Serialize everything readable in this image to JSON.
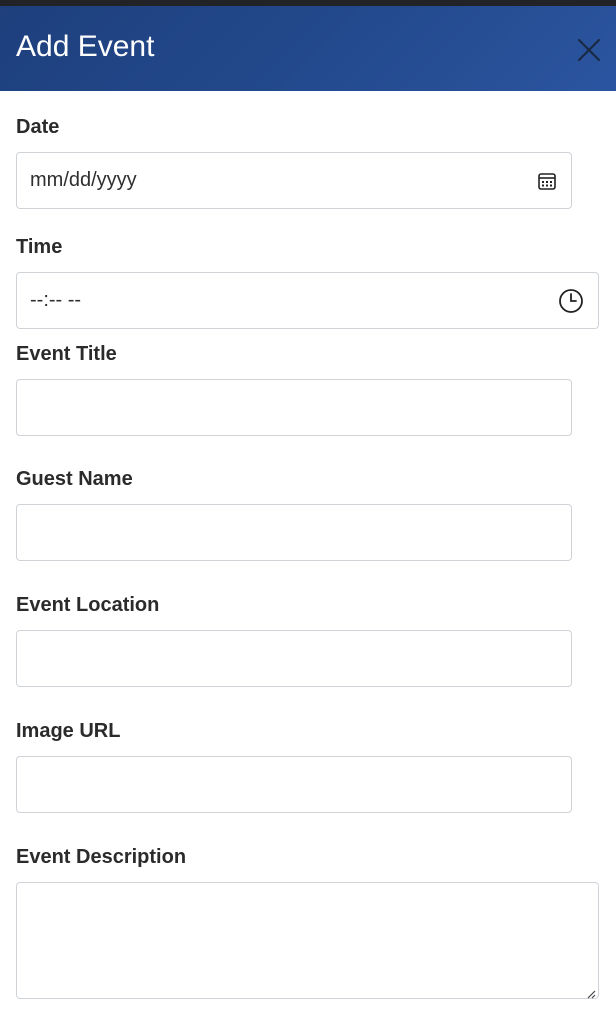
{
  "modal": {
    "title": "Add Event",
    "close_icon": "close-icon"
  },
  "form": {
    "date": {
      "label": "Date",
      "value": "mm/dd/yyyy",
      "icon": "calendar-icon"
    },
    "time": {
      "label": "Time",
      "value": "--:-- --",
      "icon": "clock-icon"
    },
    "event_title": {
      "label": "Event Title",
      "value": ""
    },
    "guest_name": {
      "label": "Guest Name",
      "value": ""
    },
    "event_location": {
      "label": "Event Location",
      "value": ""
    },
    "image_url": {
      "label": "Image URL",
      "value": ""
    },
    "event_description": {
      "label": "Event Description",
      "value": ""
    }
  },
  "colors": {
    "header_start": "#1e3f7c",
    "header_end": "#2b55a0",
    "label_text": "#2b2b2b",
    "field_border": "#cfd3d8"
  }
}
